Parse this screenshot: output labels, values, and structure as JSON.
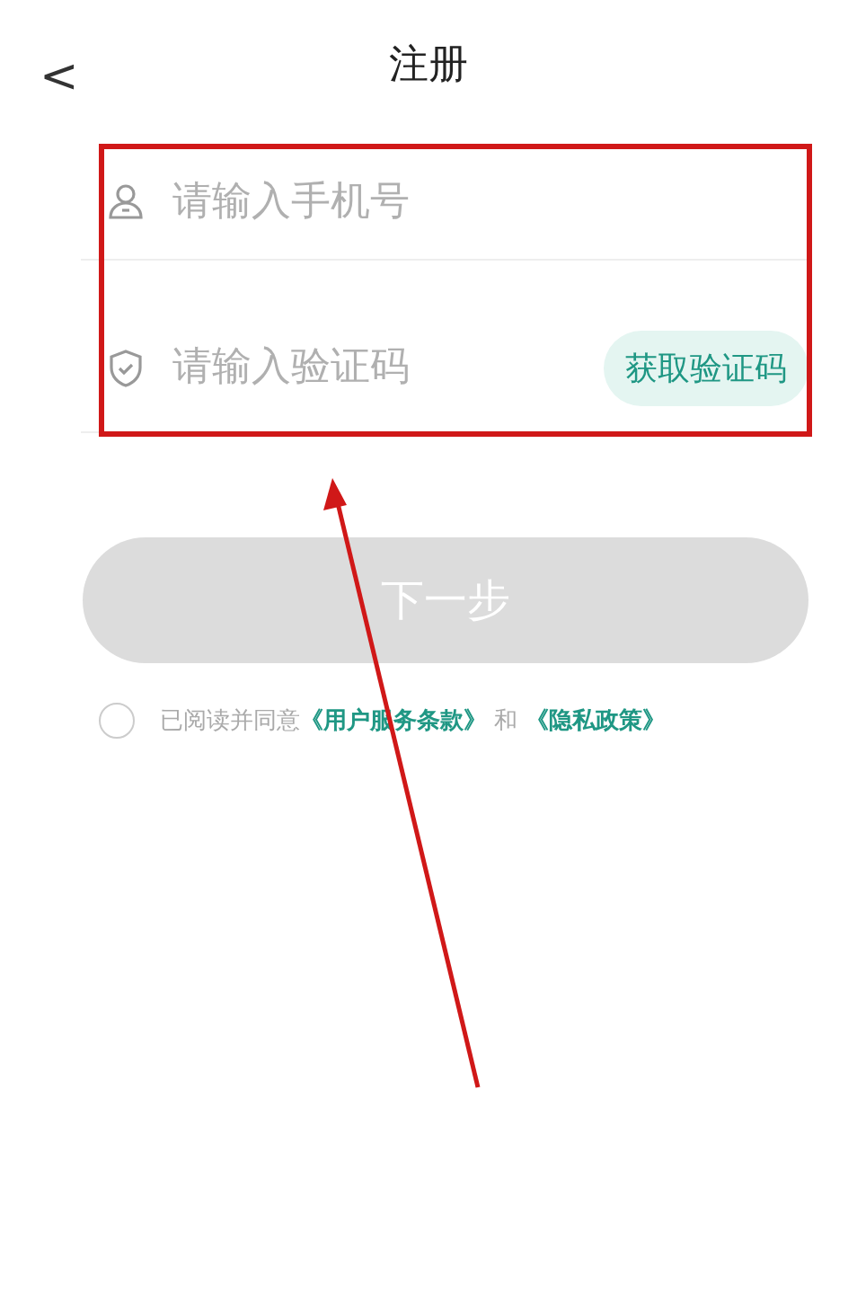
{
  "header": {
    "back": "<",
    "title": "注册"
  },
  "fields": [
    {
      "kind": "phone",
      "placeholder": "请输入手机号"
    },
    {
      "kind": "code",
      "placeholder": "请输入验证码",
      "action": "获取验证码"
    }
  ],
  "next_button": {
    "label": "下一步",
    "disabled": true
  },
  "agreement": {
    "checked": false,
    "prefix": "已阅读并同意",
    "links": [
      "《用户服务条款》",
      "《隐私政策》"
    ],
    "joiner": "和"
  }
}
